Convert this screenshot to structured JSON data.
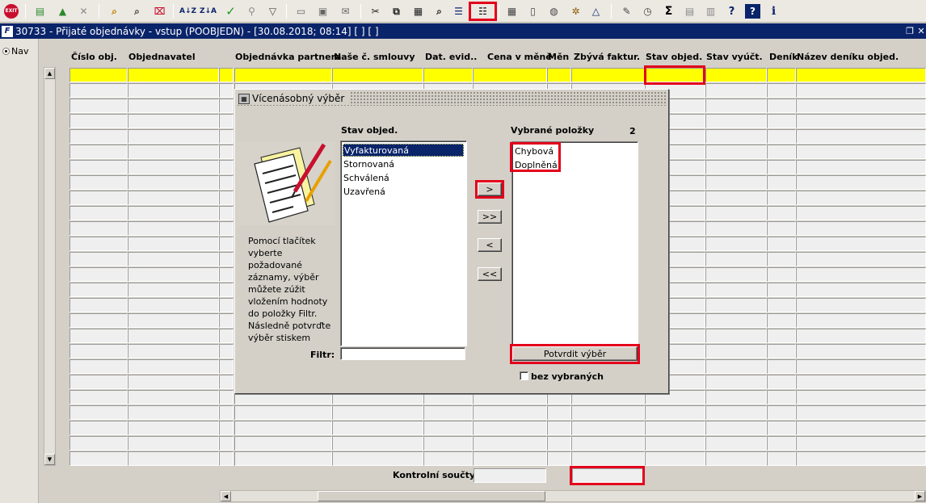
{
  "toolbar": {
    "exit_label": "EXIT",
    "sort_asc_label": "A↓Z",
    "sort_desc_label": "Z↓A",
    "sum_label": "Σ",
    "help_label": "?",
    "info_label": "i"
  },
  "window": {
    "title": "30733 - Přijaté objednávky - vstup (POOBJEDN) - [30.08.2018; 08:14]  [ ] [ ]",
    "logo": "F"
  },
  "nav": {
    "label": "Nav"
  },
  "grid": {
    "columns": [
      "Číslo obj.",
      "Objednavatel",
      "Objednávka partnera",
      "Naše č. smlouvy",
      "Dat. evid..",
      "Cena v měně",
      "Měn",
      "Zbývá faktur.",
      "Stav objed.",
      "Stav vyúčt.",
      "Deník",
      "Název deníku objed."
    ]
  },
  "totals": {
    "label": "Kontrolní součty"
  },
  "dialog": {
    "title": "Vícenásobný výběr",
    "source_title": "Stav objed.",
    "source_items": [
      "Vyfakturovaná",
      "Stornovaná",
      "Schválená",
      "Uzavřená"
    ],
    "selected_title": "Vybrané položky",
    "selected_count": "2",
    "selected_items": [
      "Chybová",
      "Doplněná"
    ],
    "help_text": "Pomocí tlačítek vyberte požadované záznamy, výběr můžete zúžit vložením hodnoty do položky Filtr. Následně potvrďte výběr stiskem",
    "filter_label": "Filtr:",
    "filter_value": "",
    "btn_add": ">",
    "btn_add_all": ">>",
    "btn_remove": "<",
    "btn_remove_all": "<<",
    "confirm_label": "Potvrdit výběr",
    "without_selected_label": "bez vybraných"
  },
  "colors": {
    "title_bar": "#0a246a",
    "highlight_row": "#ffff00",
    "annotation": "#e3001b"
  }
}
